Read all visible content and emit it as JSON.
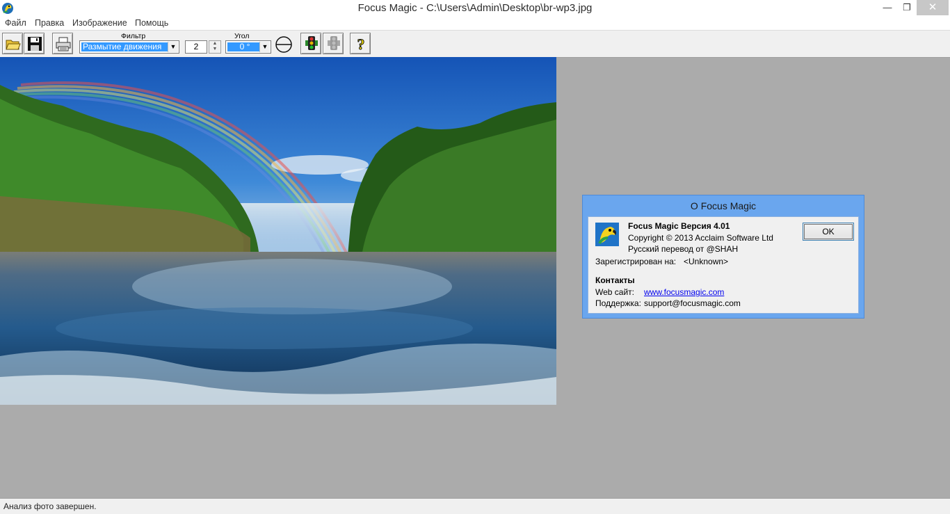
{
  "window": {
    "title": "Focus Magic - C:\\Users\\Admin\\Desktop\\br-wp3.jpg",
    "minimize": "—",
    "restore": "❐",
    "close": "✕"
  },
  "menu": {
    "items": [
      "Файл",
      "Правка",
      "Изображение",
      "Помощь"
    ]
  },
  "toolbar": {
    "filter_label": "Фильтр",
    "filter_value": "Размытие движения",
    "amount_value": "2",
    "angle_label": "Угол",
    "angle_value": "0 °"
  },
  "status": {
    "text": "Анализ фото завершен."
  },
  "about_dialog": {
    "title": "О Focus Magic",
    "product": "Focus Magic Версия  4.01",
    "copyright": "Copyright © 2013 Acclaim Software Ltd",
    "translation": "Русский перевод от @SHAH",
    "registered_label": "Зарегистрирован на:",
    "registered_value": "<Unknown>",
    "contacts_heading": "Контакты",
    "web_label": "Web сайт:",
    "web_value": "www.focusmagic.com",
    "support_label": "Поддержка:",
    "support_value": "support@focusmagic.com",
    "ok_label": "OK"
  },
  "colors": {
    "dialog_frame": "#6aa6ee",
    "workspace": "#ababab",
    "selection": "#3399ff"
  }
}
